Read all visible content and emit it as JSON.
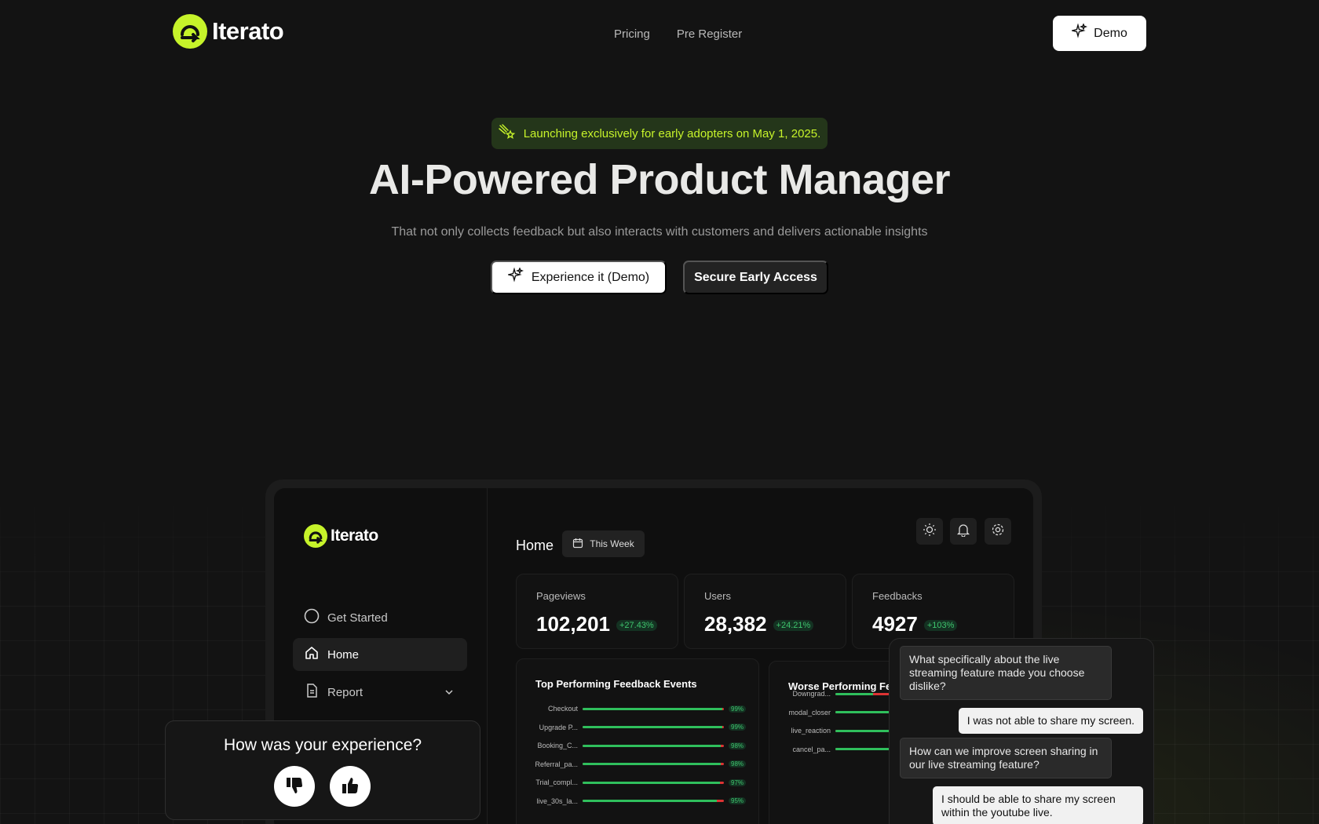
{
  "nav": {
    "brand": "Iterato",
    "links": [
      "Pricing",
      "Pre Register"
    ],
    "demo_label": "Demo"
  },
  "hero": {
    "badge": "Launching exclusively for early adopters on May 1, 2025.",
    "title": "AI-Powered Product Manager",
    "subtitle": "That not only collects feedback but also interacts with customers and delivers actionable insights",
    "primary_cta": "Experience it (Demo)",
    "secondary_cta": "Secure Early Access"
  },
  "app": {
    "brand": "Iterato",
    "sidebar": [
      {
        "label": "Get Started",
        "icon": "circle-icon"
      },
      {
        "label": "Home",
        "icon": "home-icon"
      },
      {
        "label": "Report",
        "icon": "document-icon"
      }
    ],
    "page_title": "Home",
    "range_label": "This Week",
    "stats": [
      {
        "label": "Pageviews",
        "value": "102,201",
        "delta": "+27.43%"
      },
      {
        "label": "Users",
        "value": "28,382",
        "delta": "+24.21%"
      },
      {
        "label": "Feedbacks",
        "value": "4927",
        "delta": "+103%"
      }
    ],
    "top_panel": {
      "title": "Top Performing Feedback Events",
      "rows": [
        {
          "label": "Checkout",
          "pct": "99%",
          "value": 0.99
        },
        {
          "label": "Upgrade P...",
          "pct": "99%",
          "value": 0.99
        },
        {
          "label": "Booking_C...",
          "pct": "98%",
          "value": 0.98
        },
        {
          "label": "Referral_pa...",
          "pct": "98%",
          "value": 0.98
        },
        {
          "label": "Trial_compl...",
          "pct": "97%",
          "value": 0.97
        },
        {
          "label": "live_30s_la...",
          "pct": "95%",
          "value": 0.95
        }
      ]
    },
    "worse_panel": {
      "title": "Worse Performing Fee",
      "rows": [
        {
          "label": "Downgrad...",
          "value": 0.2
        },
        {
          "label": "modal_closer",
          "value": 0.3
        },
        {
          "label": "live_reaction",
          "value": 0.6
        },
        {
          "label": "cancel_pa...",
          "value": 0.7
        }
      ]
    }
  },
  "chat": {
    "messages": [
      {
        "role": "ai",
        "text": "What specifically about the live streaming feature made you choose dislike?"
      },
      {
        "role": "user",
        "text": "I was not able to share my screen."
      },
      {
        "role": "ai",
        "text": "How can we improve screen sharing in our live streaming feature?"
      },
      {
        "role": "user",
        "text": "I should be able to share my screen within the youtube live."
      }
    ]
  },
  "feedback": {
    "question": "How was your experience?"
  },
  "colors": {
    "accent": "#c6f32a",
    "bg": "#131313",
    "positive": "#2fbf5c",
    "negative": "#dd3333"
  }
}
